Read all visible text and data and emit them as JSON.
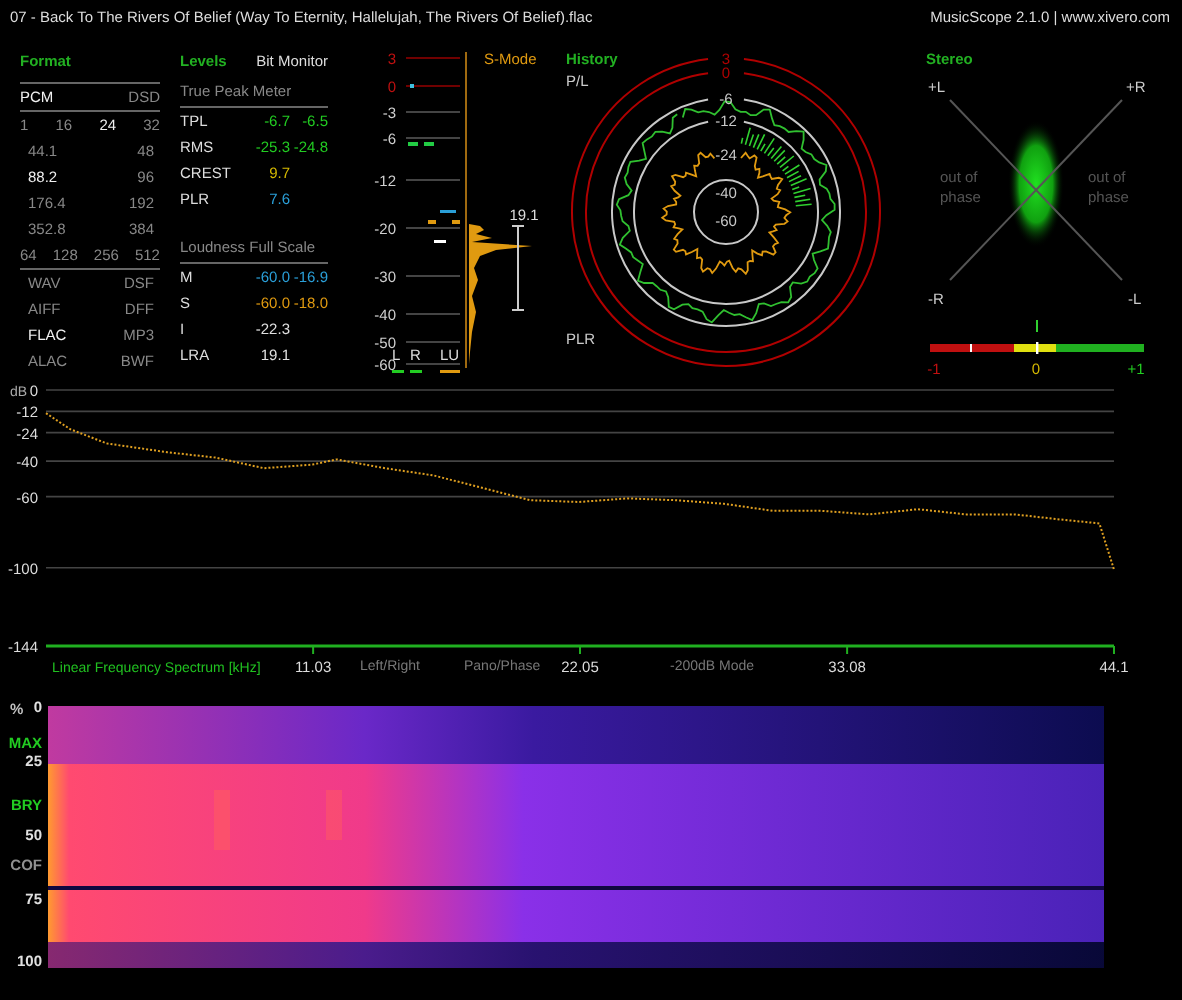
{
  "title_bar": {
    "track": "07 - Back To The Rivers Of Belief (Way To Eternity, Hallelujah, The Rivers Of Belief).flac",
    "app": "MusicScope 2.1.0 | www.xivero.com"
  },
  "format": {
    "title": "Format",
    "groups": [
      [
        [
          {
            "label": "PCM",
            "selected": true
          },
          {
            "label": "DSD",
            "selected": false
          }
        ]
      ],
      [
        [
          {
            "label": "1",
            "selected": false
          },
          {
            "label": "16",
            "selected": false
          },
          {
            "label": "24",
            "selected": true
          },
          {
            "label": "32",
            "selected": false
          }
        ],
        [
          {
            "label": "44.1",
            "selected": false
          },
          {
            "label": "48",
            "selected": false
          }
        ],
        [
          {
            "label": "88.2",
            "selected": true
          },
          {
            "label": "96",
            "selected": false
          }
        ],
        [
          {
            "label": "176.4",
            "selected": false
          },
          {
            "label": "192",
            "selected": false
          }
        ],
        [
          {
            "label": "352.8",
            "selected": false
          },
          {
            "label": "384",
            "selected": false
          }
        ],
        [
          {
            "label": "64",
            "selected": false
          },
          {
            "label": "128",
            "selected": false
          },
          {
            "label": "256",
            "selected": false
          },
          {
            "label": "512",
            "selected": false
          }
        ]
      ],
      [
        [
          {
            "label": "WAV",
            "selected": false
          },
          {
            "label": "DSF",
            "selected": false
          }
        ],
        [
          {
            "label": "AIFF",
            "selected": false
          },
          {
            "label": "DFF",
            "selected": false
          }
        ],
        [
          {
            "label": "FLAC",
            "selected": true
          },
          {
            "label": "MP3",
            "selected": false
          }
        ],
        [
          {
            "label": "ALAC",
            "selected": false
          },
          {
            "label": "BWF",
            "selected": false
          }
        ]
      ]
    ]
  },
  "levels": {
    "title": "Levels",
    "bit_monitor": "Bit Monitor",
    "sections": [
      {
        "title": "True Peak Meter",
        "rows": [
          {
            "label": "TPL",
            "values": [
              {
                "text": "-6.7",
                "color": "#22cc22"
              },
              {
                "text": "-6.5",
                "color": "#22cc22"
              }
            ]
          },
          {
            "label": "RMS",
            "values": [
              {
                "text": "-25.3",
                "color": "#22cc22"
              },
              {
                "text": "-24.8",
                "color": "#22cc22"
              }
            ]
          },
          {
            "label": "CREST",
            "values": [
              {
                "text": "9.7",
                "color": "#d4b800"
              }
            ]
          },
          {
            "label": "PLR",
            "values": [
              {
                "text": "7.6",
                "color": "#2a9fd8"
              }
            ]
          }
        ]
      },
      {
        "title": "Loudness Full Scale",
        "rows": [
          {
            "label": "M",
            "values": [
              {
                "text": "-60.0",
                "color": "#2a9fd8"
              },
              {
                "text": "-16.9",
                "color": "#2a9fd8"
              }
            ]
          },
          {
            "label": "S",
            "values": [
              {
                "text": "-60.0",
                "color": "#e09a10"
              },
              {
                "text": "-18.0",
                "color": "#e09a10"
              }
            ]
          },
          {
            "label": "I",
            "values": [
              {
                "text": "-22.3",
                "color": "#e0e0e0"
              }
            ]
          },
          {
            "label": "LRA",
            "values": [
              {
                "text": "19.1",
                "color": "#e0e0e0"
              }
            ]
          }
        ]
      }
    ]
  },
  "meter": {
    "mode": "S-Mode",
    "ticks": [
      {
        "label": "3",
        "color": "#c01010"
      },
      {
        "label": "0",
        "color": "#c01010"
      },
      {
        "label": "-3",
        "color": "#d0d0d0"
      },
      {
        "label": "-6",
        "color": "#d0d0d0"
      },
      {
        "label": "-12",
        "color": "#d0d0d0"
      },
      {
        "label": "-20",
        "color": "#d0d0d0"
      },
      {
        "label": "-30",
        "color": "#d0d0d0"
      },
      {
        "label": "-40",
        "color": "#d0d0d0"
      },
      {
        "label": "-50",
        "color": "#d0d0d0"
      },
      {
        "label": "-60",
        "color": "#d0d0d0"
      }
    ],
    "channels": [
      {
        "label": "L",
        "color": "#22cc22"
      },
      {
        "label": "R",
        "color": "#22cc22"
      },
      {
        "label": "LU",
        "color": "#e09a10"
      }
    ],
    "lra": "19.1"
  },
  "history": {
    "title": "History",
    "top_label": "P/L",
    "bottom_label": "PLR",
    "rings": [
      {
        "label": "3",
        "color": "#b00000"
      },
      {
        "label": "0",
        "color": "#b00000"
      },
      {
        "label": "-6",
        "color": "#c8c8c8"
      },
      {
        "label": "-12",
        "color": "#c8c8c8"
      },
      {
        "label": "-24",
        "color": "#c8c8c8"
      },
      {
        "label": "-40",
        "color": "#c8c8c8"
      },
      {
        "label": "-60",
        "color": "#c8c8c8"
      }
    ]
  },
  "stereo": {
    "title": "Stereo",
    "corners": [
      "+L",
      "+R",
      "-R",
      "-L"
    ],
    "out_of_phase": [
      [
        "out of",
        "phase"
      ],
      [
        "out of",
        "phase"
      ]
    ],
    "correlation": {
      "labels": [
        {
          "text": "-1",
          "color": "#c01010"
        },
        {
          "text": "0",
          "color": "#d4b800"
        },
        {
          "text": "+1",
          "color": "#22cc22"
        }
      ]
    }
  },
  "spectrum": {
    "modes": [
      "Left/Right",
      "Pano/Phase",
      "-200dB Mode"
    ],
    "chart_data": {
      "type": "line",
      "xlabel": "Linear Frequency Spectrum [kHz]",
      "ylabel": "dB",
      "xlim": [
        0,
        44.1
      ],
      "ylim": [
        -144,
        0
      ],
      "xticks": [
        11.03,
        22.05,
        33.08,
        44.1
      ],
      "yticks": [
        0,
        -12,
        -24,
        -40,
        -60,
        -100,
        -144
      ],
      "x": [
        0,
        1,
        2.5,
        5,
        7,
        9,
        11,
        12,
        14,
        16,
        18,
        20,
        22,
        24,
        26,
        28,
        30,
        32,
        34,
        36,
        38,
        40,
        42,
        43.5,
        44.1
      ],
      "grid": true,
      "series": [
        {
          "line_style": "dotted",
          "color": "#e0a020",
          "values": [
            -13,
            -22,
            -30,
            -35,
            -38,
            -44,
            -42,
            -39,
            -44,
            -48,
            -55,
            -62,
            -63,
            -61,
            -62,
            -64,
            -68,
            -68,
            -70,
            -67,
            -70,
            -70,
            -73,
            -75,
            -101
          ]
        }
      ]
    }
  },
  "spectrogram": {
    "scale": [
      {
        "label": "%",
        "color": "#c0c0c0"
      },
      {
        "label": "0",
        "color": "#e0e0e0"
      },
      {
        "label": "MAX",
        "color": "#22cc22"
      },
      {
        "label": "25",
        "color": "#e0e0e0"
      },
      {
        "label": "BRY",
        "color": "#22cc22"
      },
      {
        "label": "50",
        "color": "#e0e0e0"
      },
      {
        "label": "COF",
        "color": "#909090"
      },
      {
        "label": "75",
        "color": "#e0e0e0"
      },
      {
        "label": "100",
        "color": "#e0e0e0"
      }
    ]
  }
}
